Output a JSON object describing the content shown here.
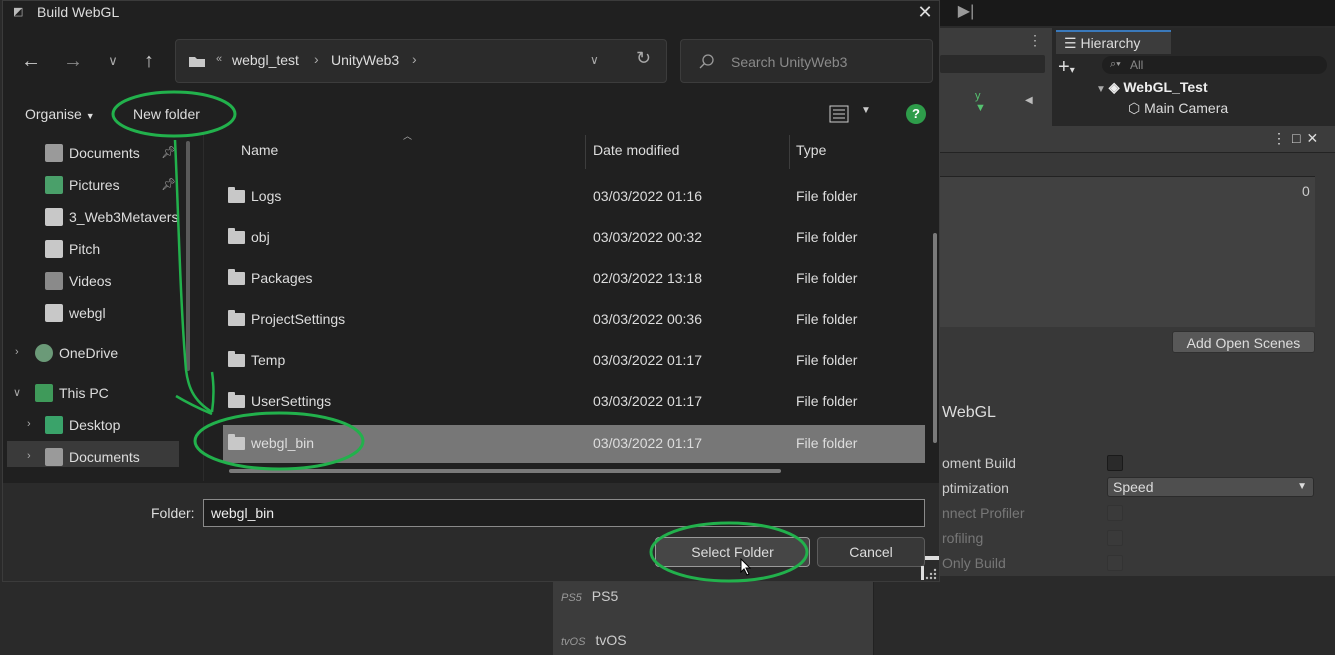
{
  "dialog": {
    "title": "Build WebGL",
    "address": {
      "overflow": "«",
      "segments": [
        "webgl_test",
        "UnityWeb3"
      ]
    },
    "search_placeholder": "Search UnityWeb3",
    "commands": {
      "organise": "Organise",
      "new_folder": "New folder",
      "help": "?"
    },
    "nav": [
      {
        "label": "Documents",
        "icon": "documents-icon",
        "pinned": true
      },
      {
        "label": "Pictures",
        "icon": "pictures-icon",
        "pinned": true
      },
      {
        "label": "3_Web3Metavers",
        "icon": "folder-icon"
      },
      {
        "label": "Pitch",
        "icon": "folder-icon"
      },
      {
        "label": "Videos",
        "icon": "videos-icon"
      },
      {
        "label": "webgl",
        "icon": "folder-icon"
      },
      {
        "label": "OneDrive",
        "icon": "cloud-icon"
      },
      {
        "label": "This PC",
        "icon": "pc-icon"
      },
      {
        "label": "Desktop",
        "icon": "desktop-icon"
      },
      {
        "label": "Documents",
        "icon": "documents-icon",
        "selected": true
      }
    ],
    "columns": {
      "name": "Name",
      "date": "Date modified",
      "type": "Type"
    },
    "files": [
      {
        "name": "Logs",
        "date": "03/03/2022 01:16",
        "type": "File folder"
      },
      {
        "name": "obj",
        "date": "03/03/2022 00:32",
        "type": "File folder"
      },
      {
        "name": "Packages",
        "date": "02/03/2022 13:18",
        "type": "File folder"
      },
      {
        "name": "ProjectSettings",
        "date": "03/03/2022 00:36",
        "type": "File folder"
      },
      {
        "name": "Temp",
        "date": "03/03/2022 01:17",
        "type": "File folder"
      },
      {
        "name": "UserSettings",
        "date": "03/03/2022 01:17",
        "type": "File folder"
      },
      {
        "name": "webgl_bin",
        "date": "03/03/2022 01:17",
        "type": "File folder",
        "selected": true
      }
    ],
    "folder_label": "Folder:",
    "folder_value": "webgl_bin",
    "select_button": "Select Folder",
    "cancel_button": "Cancel"
  },
  "unity": {
    "hierarchy_tab": "Hierarchy",
    "hierarchy_search": "All",
    "scene_name": "WebGL_Test",
    "main_camera": "Main Camera",
    "count": "0",
    "add_open_scenes": "Add Open Scenes",
    "platform": "WebGL",
    "settings": [
      {
        "label": "oment Build",
        "dim": false,
        "checkbox": true
      },
      {
        "label": "ptimization",
        "dim": false,
        "dropdown": "Speed"
      },
      {
        "label": "nnect Profiler",
        "dim": true,
        "checkbox": true
      },
      {
        "label": "rofiling",
        "dim": true,
        "checkbox": true
      },
      {
        "label": "Only Build",
        "dim": true,
        "checkbox": true
      }
    ],
    "platforms": [
      {
        "tag": "PS5",
        "label": "PS5"
      },
      {
        "tag": "tvOS",
        "label": "tvOS"
      }
    ]
  },
  "colors": {
    "annotation": "#22b14c",
    "selected_row": "#777777"
  }
}
